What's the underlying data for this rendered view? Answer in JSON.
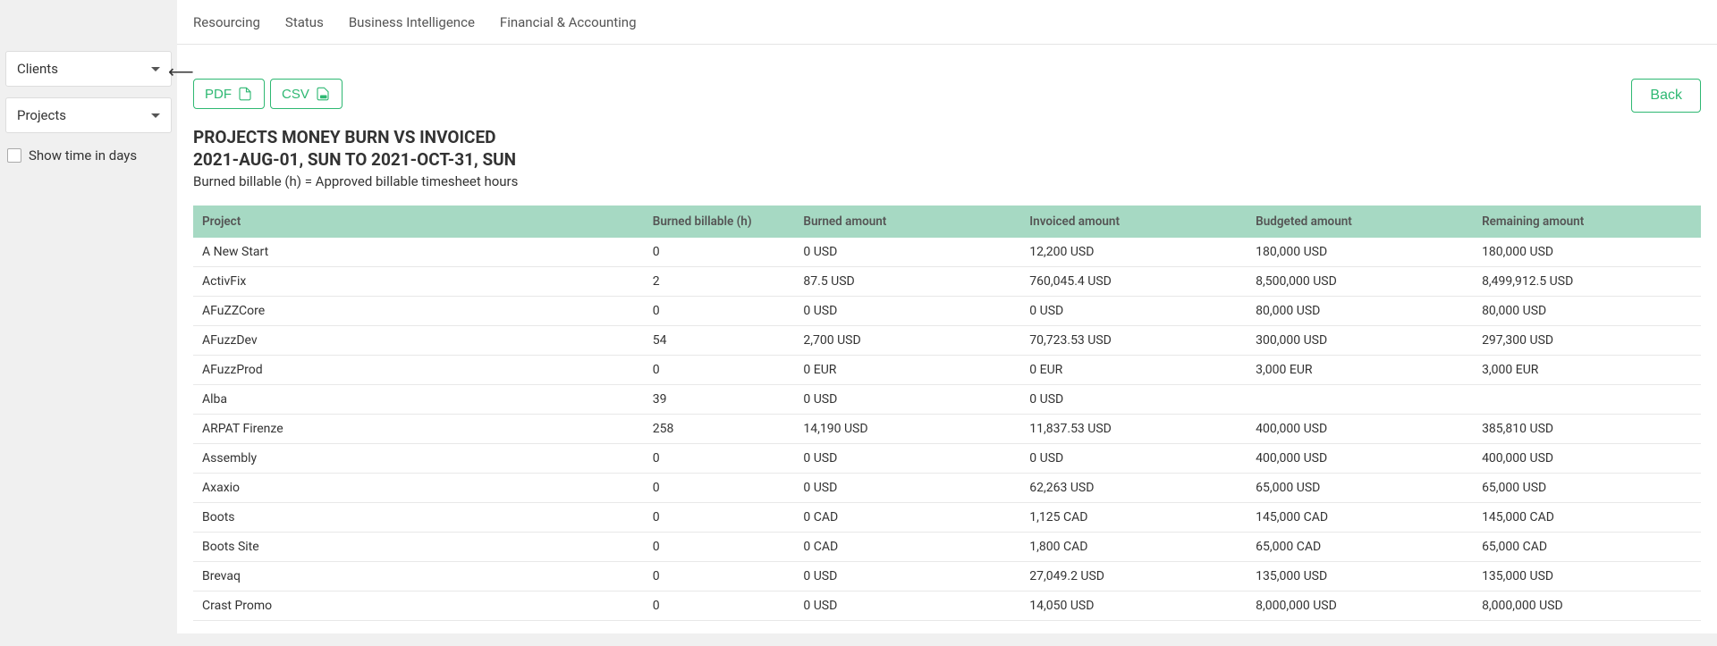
{
  "tabs": [
    "Resourcing",
    "Status",
    "Business Intelligence",
    "Financial & Accounting"
  ],
  "sidebar": {
    "clients_label": "Clients",
    "projects_label": "Projects",
    "show_days_label": "Show time in days"
  },
  "export": {
    "pdf": "PDF",
    "csv": "CSV"
  },
  "back_label": "Back",
  "title": "PROJECTS MONEY BURN VS INVOICED",
  "subtitle": "2021-AUG-01, SUN TO 2021-OCT-31, SUN",
  "note": "Burned billable (h) = Approved billable timesheet hours",
  "columns": [
    "Project",
    "Burned billable (h)",
    "Burned amount",
    "Invoiced amount",
    "Budgeted amount",
    "Remaining amount"
  ],
  "rows": [
    {
      "project": "A New Start",
      "hours": "0",
      "burned": "0 USD",
      "invoiced": "12,200 USD",
      "budgeted": "180,000 USD",
      "remaining": "180,000 USD"
    },
    {
      "project": "ActivFix",
      "hours": "2",
      "burned": "87.5 USD",
      "invoiced": "760,045.4 USD",
      "budgeted": "8,500,000 USD",
      "remaining": "8,499,912.5 USD"
    },
    {
      "project": "AFuZZCore",
      "hours": "0",
      "burned": "0 USD",
      "invoiced": "0 USD",
      "budgeted": "80,000 USD",
      "remaining": "80,000 USD"
    },
    {
      "project": "AFuzzDev",
      "hours": "54",
      "burned": "2,700 USD",
      "invoiced": "70,723.53 USD",
      "budgeted": "300,000 USD",
      "remaining": "297,300 USD"
    },
    {
      "project": "AFuzzProd",
      "hours": "0",
      "burned": "0 EUR",
      "invoiced": "0 EUR",
      "budgeted": "3,000 EUR",
      "remaining": "3,000 EUR"
    },
    {
      "project": "Alba",
      "hours": "39",
      "burned": "0 USD",
      "invoiced": "0 USD",
      "budgeted": "",
      "remaining": ""
    },
    {
      "project": "ARPAT Firenze",
      "hours": "258",
      "burned": "14,190 USD",
      "invoiced": "11,837.53 USD",
      "budgeted": "400,000 USD",
      "remaining": "385,810 USD"
    },
    {
      "project": "Assembly",
      "hours": "0",
      "burned": "0 USD",
      "invoiced": "0 USD",
      "budgeted": "400,000 USD",
      "remaining": "400,000 USD"
    },
    {
      "project": "Axaxio",
      "hours": "0",
      "burned": "0 USD",
      "invoiced": "62,263 USD",
      "budgeted": "65,000 USD",
      "remaining": "65,000 USD"
    },
    {
      "project": "Boots",
      "hours": "0",
      "burned": "0 CAD",
      "invoiced": "1,125 CAD",
      "budgeted": "145,000 CAD",
      "remaining": "145,000 CAD"
    },
    {
      "project": "Boots Site",
      "hours": "0",
      "burned": "0 CAD",
      "invoiced": "1,800 CAD",
      "budgeted": "65,000 CAD",
      "remaining": "65,000 CAD"
    },
    {
      "project": "Brevaq",
      "hours": "0",
      "burned": "0 USD",
      "invoiced": "27,049.2 USD",
      "budgeted": "135,000 USD",
      "remaining": "135,000 USD"
    },
    {
      "project": "Crast Promo",
      "hours": "0",
      "burned": "0 USD",
      "invoiced": "14,050 USD",
      "budgeted": "8,000,000 USD",
      "remaining": "8,000,000 USD"
    }
  ]
}
